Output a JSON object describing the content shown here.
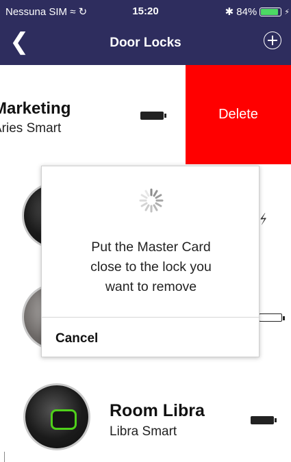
{
  "status_bar": {
    "carrier": "Nessuna SIM",
    "wifi_icon": "wifi-icon",
    "sync_icon": "sync-icon",
    "time": "15:20",
    "bluetooth_icon": "bluetooth-icon",
    "battery_percent": "84%",
    "battery_level": 0.84,
    "charging_icon": "charging-bolt-icon"
  },
  "nav": {
    "back_icon": "chevron-left-icon",
    "title": "Door Locks",
    "add_icon": "plus-circle-icon"
  },
  "locks": [
    {
      "name": "Marketing",
      "model": "Aries Smart",
      "battery": "full",
      "swipe_action": "Delete"
    },
    {
      "name": "",
      "model": "",
      "battery": "charging"
    },
    {
      "name": "",
      "model": "",
      "battery": "low"
    },
    {
      "name": "Room Libra",
      "model": "Libra Smart",
      "battery": "full"
    }
  ],
  "dialog": {
    "spinner_icon": "activity-spinner-icon",
    "message": "Put the Master Card close to the lock you want to remove",
    "cancel_label": "Cancel"
  },
  "colors": {
    "nav_background": "#2e2d5e",
    "delete_background": "#ff0000",
    "battery_green": "#4cd964",
    "lock_ring_green": "#4fd11a"
  }
}
